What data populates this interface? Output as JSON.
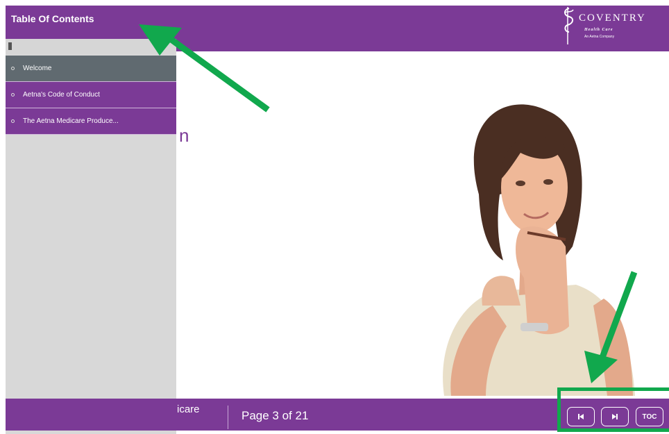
{
  "header": {
    "toc_title": "Table Of Contents",
    "logo": {
      "wordmark": "COVENTRY",
      "subline": "Health Care",
      "tagline": "An Aetna Company"
    }
  },
  "sidebar": {
    "items": [
      {
        "label": "Welcome",
        "active": true
      },
      {
        "label": "Aetna's Code of Conduct",
        "active": false
      },
      {
        "label": "The Aetna Medicare Produce...",
        "active": false
      }
    ]
  },
  "slide": {
    "partial_text": "n"
  },
  "footer": {
    "course_fragment": "icare",
    "page_indicator": "Page 3 of 21",
    "buttons": {
      "prev_icon": "skip-back-icon",
      "next_icon": "skip-forward-icon",
      "toc_label": "TOC"
    }
  },
  "annotations": {
    "arrow_color": "#11a84d"
  },
  "colors": {
    "brand_purple": "#7b3a96",
    "active_item": "#606a70",
    "sidebar_bg": "#d8d8d8"
  }
}
